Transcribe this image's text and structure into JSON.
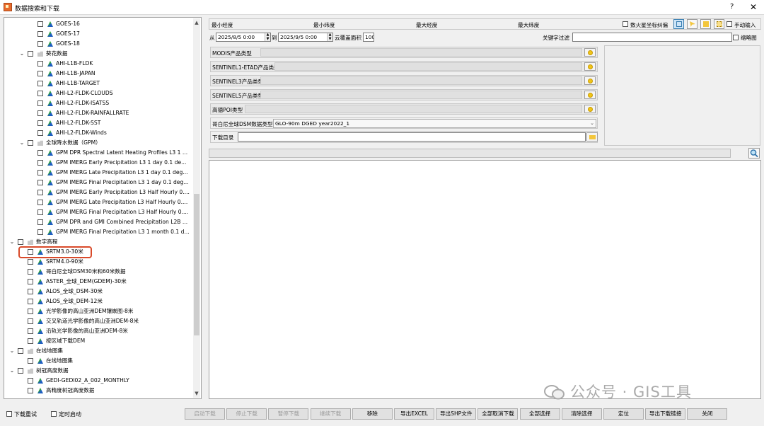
{
  "window": {
    "title": "数据搜索和下载",
    "help": "?",
    "close": "✕"
  },
  "tree": [
    {
      "level": 2,
      "type": "leaf",
      "label": "GOES-16"
    },
    {
      "level": 2,
      "type": "leaf",
      "label": "GOES-17"
    },
    {
      "level": 2,
      "type": "leaf",
      "label": "GOES-18"
    },
    {
      "level": 1,
      "type": "folder",
      "expander": "⌄",
      "label": "葵花数据"
    },
    {
      "level": 2,
      "type": "leaf",
      "label": "AHI-L1B-FLDK"
    },
    {
      "level": 2,
      "type": "leaf",
      "label": "AHI-L1B-JAPAN"
    },
    {
      "level": 2,
      "type": "leaf",
      "label": "AHI-L1B-TARGET"
    },
    {
      "level": 2,
      "type": "leaf",
      "label": "AHI-L2-FLDK-CLOUDS"
    },
    {
      "level": 2,
      "type": "leaf",
      "label": "AHI-L2-FLDK-ISATSS"
    },
    {
      "level": 2,
      "type": "leaf",
      "label": "AHI-L2-FLDK-RAINFALLRATE"
    },
    {
      "level": 2,
      "type": "leaf",
      "label": "AHI-L2-FLDK-SST"
    },
    {
      "level": 2,
      "type": "leaf",
      "label": "AHI-L2-FLDK-Winds"
    },
    {
      "level": 1,
      "type": "folder",
      "expander": "⌄",
      "label": "全球降水数据（GPM）"
    },
    {
      "level": 2,
      "type": "leaf",
      "label": "GPM DPR Spectral Latent Heating Profiles L3 1 ..."
    },
    {
      "level": 2,
      "type": "leaf",
      "label": "GPM IMERG Early Precipitation L3 1 day 0.1 de..."
    },
    {
      "level": 2,
      "type": "leaf",
      "label": "GPM IMERG Late Precipitation L3 1 day 0.1 deg..."
    },
    {
      "level": 2,
      "type": "leaf",
      "label": "GPM IMERG Final Precipitation L3 1 day 0.1 deg..."
    },
    {
      "level": 2,
      "type": "leaf",
      "label": "GPM IMERG Early Precipitation L3 Half Hourly 0...."
    },
    {
      "level": 2,
      "type": "leaf",
      "label": "GPM IMERG Late Precipitation L3 Half Hourly 0...."
    },
    {
      "level": 2,
      "type": "leaf",
      "label": "GPM IMERG Final Precipitation L3 Half Hourly 0...."
    },
    {
      "level": 2,
      "type": "leaf",
      "label": "GPM DPR and GMI Combined Precipitation L2B ..."
    },
    {
      "level": 2,
      "type": "leaf",
      "label": "GPM IMERG Final Precipitation L3 1 month 0.1 d..."
    },
    {
      "level": 0,
      "type": "folder",
      "expander": "⌄",
      "label": "数字高程"
    },
    {
      "level": 1,
      "type": "leaf",
      "label": "SRTM3.0-30米"
    },
    {
      "level": 1,
      "type": "leaf",
      "label": "SRTM4.0-90米"
    },
    {
      "level": 1,
      "type": "leaf",
      "label": "哥白尼全球DSM30米和60米数据"
    },
    {
      "level": 1,
      "type": "leaf",
      "label": "ASTER_全球_DEM(GDEM)-30米"
    },
    {
      "level": 1,
      "type": "leaf",
      "label": "ALOS_全球_DSM-30米"
    },
    {
      "level": 1,
      "type": "leaf",
      "label": "ALOS_全球_DEM-12米"
    },
    {
      "level": 1,
      "type": "leaf",
      "label": "光学影像的高山亚洲DEM镶嵌图-8米"
    },
    {
      "level": 1,
      "type": "leaf",
      "label": "交叉轨道光学影像的高山亚洲DEM-8米"
    },
    {
      "level": 1,
      "type": "leaf",
      "label": "沿轨光学影像的高山亚洲DEM-8米"
    },
    {
      "level": 1,
      "type": "leaf",
      "label": "按区域下载DEM"
    },
    {
      "level": 0,
      "type": "folder",
      "expander": "⌄",
      "label": "在线地图集"
    },
    {
      "level": 1,
      "type": "leaf",
      "label": "在线地图集"
    },
    {
      "level": 0,
      "type": "folder",
      "expander": "⌄",
      "label": "树冠高度数据"
    },
    {
      "level": 1,
      "type": "leaf",
      "label": "GEDI-GEDI02_A_002_MONTHLY"
    },
    {
      "level": 1,
      "type": "leaf",
      "label": "高精度树冠高度数据"
    }
  ],
  "coords": {
    "min_lon": "最小经度",
    "min_lat": "最小纬度",
    "max_lon": "最大经度",
    "max_lat": "最大纬度",
    "mars_label": "数火星坐标纠偏",
    "manual_label": "手动输入"
  },
  "filter": {
    "from_label": "从",
    "from_value": "2025/8/5  0:00",
    "to_label": "到",
    "to_value": "2025/9/5  0:00",
    "cloud_label": "云覆盖面积",
    "cloud_value": "100",
    "keyword_label": "关键字过滤",
    "keyword_value": "",
    "thumb_label": "缩略图"
  },
  "product_types": [
    {
      "label": "MODIS产品类型"
    },
    {
      "label": "SENTINEL1-ETAD产品类型"
    },
    {
      "label": "SENTINEL3产品类型"
    },
    {
      "label": "SENTINEL5产品类型"
    },
    {
      "label": "高德POI类型"
    }
  ],
  "dsm": {
    "label": "哥白尼全球DSM数据类型",
    "value": "GLO-90m DGED year2022_1"
  },
  "download_dir": {
    "label": "下载目录",
    "value": ""
  },
  "bottom": {
    "retry_label": "下载重试",
    "timer_label": "定时启动",
    "buttons": [
      {
        "label": "启动下载",
        "enabled": false
      },
      {
        "label": "停止下载",
        "enabled": false
      },
      {
        "label": "暂停下载",
        "enabled": false
      },
      {
        "label": "继续下载",
        "enabled": false
      },
      {
        "label": "移除",
        "enabled": true
      },
      {
        "label": "导出EXCEL",
        "enabled": true
      },
      {
        "label": "导出SHP文件",
        "enabled": true
      },
      {
        "label": "全部取消下载",
        "enabled": true
      },
      {
        "label": "全部选择",
        "enabled": true
      },
      {
        "label": "清除选择",
        "enabled": true
      },
      {
        "label": "定位",
        "enabled": true
      },
      {
        "label": "导出下载链接",
        "enabled": true
      },
      {
        "label": "关闭",
        "enabled": true
      }
    ]
  },
  "watermark": {
    "text": "公众号 · GIS工具"
  },
  "colors": {
    "highlight": "#d94a2a",
    "accent": "#3c7fb1"
  }
}
